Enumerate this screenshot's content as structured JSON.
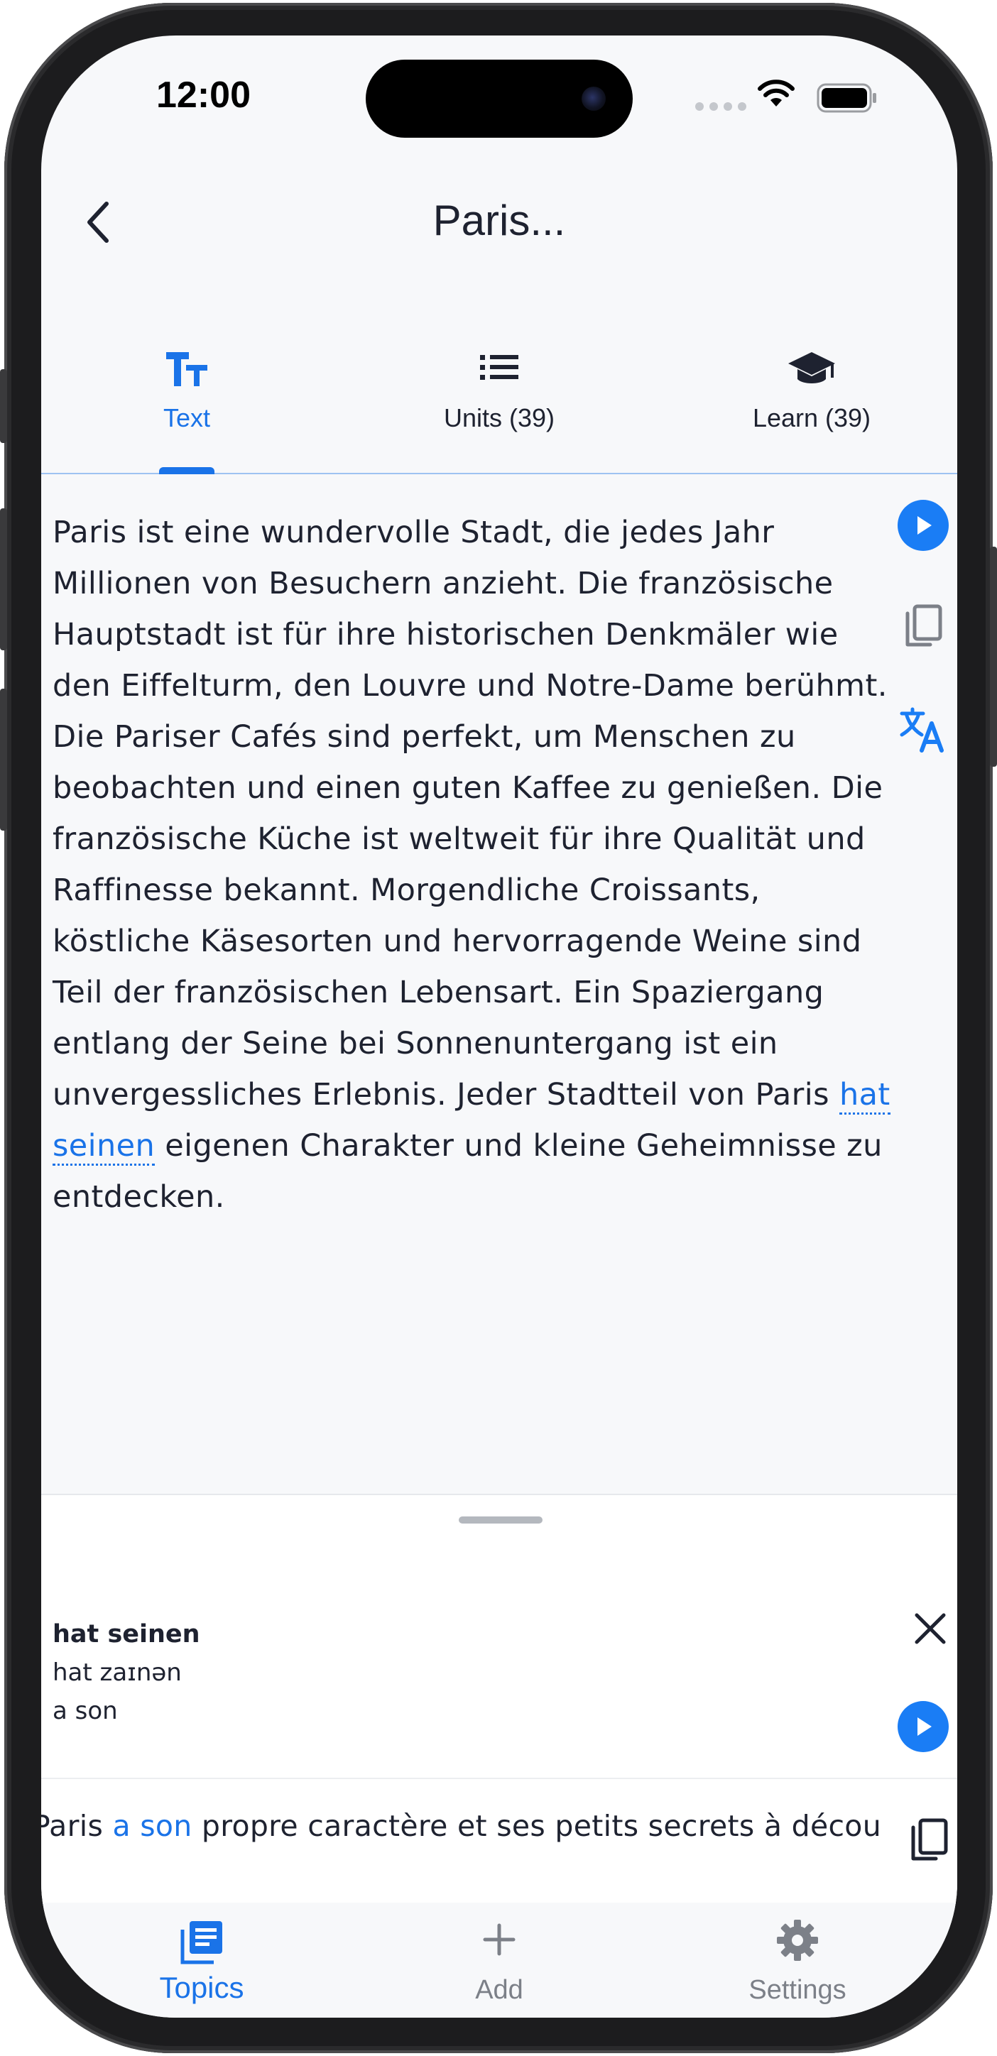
{
  "status_bar": {
    "time": "12:00"
  },
  "header": {
    "title": "Paris..."
  },
  "tabs": [
    {
      "label": "Text",
      "icon": "text-format-icon",
      "active": true
    },
    {
      "label": "Units (39)",
      "icon": "list-icon",
      "active": false
    },
    {
      "label": "Learn (39)",
      "icon": "graduation-cap-icon",
      "active": false
    }
  ],
  "reading": {
    "before": "Paris ist eine wundervolle Stadt, die jedes Jahr Millionen von Besuchern anzieht. Die französische Hauptstadt ist für ihre historischen Denkmäler wie den Eiffelturm, den Louvre und Notre-Dame berühmt. Die Pariser Cafés sind perfekt, um Menschen zu beobachten und einen guten Kaffee zu genießen. Die französische Küche ist weltweit für ihre Qualität und Raffinesse bekannt. Morgendliche Croissants, köstliche Käsesorten und hervorragende Weine sind Teil der französischen Lebensart. Ein Spaziergang entlang der Seine bei Sonnenuntergang ist ein unvergessliches Erlebnis. Jeder Stadtteil von Paris ",
    "highlight": "hat seinen",
    "after": " eigenen Charakter und kleine Geheimnisse zu entdecken."
  },
  "side_actions": [
    "play-icon",
    "copy-icon",
    "translate-icon"
  ],
  "sheet": {
    "word": "hat seinen",
    "ipa": "hat zaɪnən",
    "meaning": "a son",
    "sentence_before": "Paris ",
    "sentence_highlight": "a son",
    "sentence_after": " propre caractère et ses petits secrets à découvrir."
  },
  "bottom_nav": [
    {
      "label": "Topics",
      "icon": "topics-icon",
      "active": true
    },
    {
      "label": "Add",
      "icon": "plus-icon",
      "active": false
    },
    {
      "label": "Settings",
      "icon": "gear-icon",
      "active": false
    }
  ],
  "colors": {
    "accent": "#1a73e8",
    "text": "#1e2230",
    "muted": "#7c8088",
    "background": "#f7f8fa"
  }
}
